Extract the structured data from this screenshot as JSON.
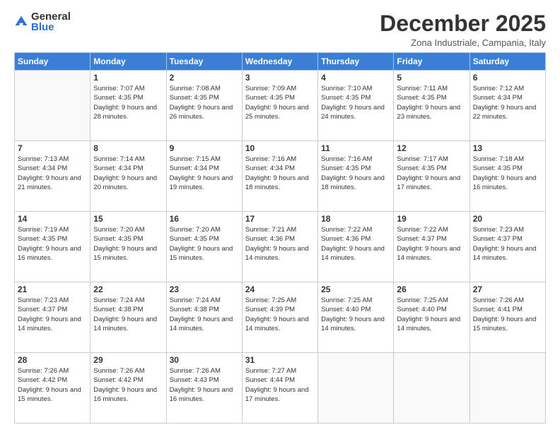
{
  "logo": {
    "general": "General",
    "blue": "Blue"
  },
  "title": "December 2025",
  "subtitle": "Zona Industriale, Campania, Italy",
  "days_header": [
    "Sunday",
    "Monday",
    "Tuesday",
    "Wednesday",
    "Thursday",
    "Friday",
    "Saturday"
  ],
  "weeks": [
    [
      {
        "day": "",
        "info": ""
      },
      {
        "day": "1",
        "sunrise": "7:07 AM",
        "sunset": "4:35 PM",
        "daylight": "9 hours and 28 minutes."
      },
      {
        "day": "2",
        "sunrise": "7:08 AM",
        "sunset": "4:35 PM",
        "daylight": "9 hours and 26 minutes."
      },
      {
        "day": "3",
        "sunrise": "7:09 AM",
        "sunset": "4:35 PM",
        "daylight": "9 hours and 25 minutes."
      },
      {
        "day": "4",
        "sunrise": "7:10 AM",
        "sunset": "4:35 PM",
        "daylight": "9 hours and 24 minutes."
      },
      {
        "day": "5",
        "sunrise": "7:11 AM",
        "sunset": "4:35 PM",
        "daylight": "9 hours and 23 minutes."
      },
      {
        "day": "6",
        "sunrise": "7:12 AM",
        "sunset": "4:34 PM",
        "daylight": "9 hours and 22 minutes."
      }
    ],
    [
      {
        "day": "7",
        "sunrise": "7:13 AM",
        "sunset": "4:34 PM",
        "daylight": "9 hours and 21 minutes."
      },
      {
        "day": "8",
        "sunrise": "7:14 AM",
        "sunset": "4:34 PM",
        "daylight": "9 hours and 20 minutes."
      },
      {
        "day": "9",
        "sunrise": "7:15 AM",
        "sunset": "4:34 PM",
        "daylight": "9 hours and 19 minutes."
      },
      {
        "day": "10",
        "sunrise": "7:16 AM",
        "sunset": "4:34 PM",
        "daylight": "9 hours and 18 minutes."
      },
      {
        "day": "11",
        "sunrise": "7:16 AM",
        "sunset": "4:35 PM",
        "daylight": "9 hours and 18 minutes."
      },
      {
        "day": "12",
        "sunrise": "7:17 AM",
        "sunset": "4:35 PM",
        "daylight": "9 hours and 17 minutes."
      },
      {
        "day": "13",
        "sunrise": "7:18 AM",
        "sunset": "4:35 PM",
        "daylight": "9 hours and 16 minutes."
      }
    ],
    [
      {
        "day": "14",
        "sunrise": "7:19 AM",
        "sunset": "4:35 PM",
        "daylight": "9 hours and 16 minutes."
      },
      {
        "day": "15",
        "sunrise": "7:20 AM",
        "sunset": "4:35 PM",
        "daylight": "9 hours and 15 minutes."
      },
      {
        "day": "16",
        "sunrise": "7:20 AM",
        "sunset": "4:35 PM",
        "daylight": "9 hours and 15 minutes."
      },
      {
        "day": "17",
        "sunrise": "7:21 AM",
        "sunset": "4:36 PM",
        "daylight": "9 hours and 14 minutes."
      },
      {
        "day": "18",
        "sunrise": "7:22 AM",
        "sunset": "4:36 PM",
        "daylight": "9 hours and 14 minutes."
      },
      {
        "day": "19",
        "sunrise": "7:22 AM",
        "sunset": "4:37 PM",
        "daylight": "9 hours and 14 minutes."
      },
      {
        "day": "20",
        "sunrise": "7:23 AM",
        "sunset": "4:37 PM",
        "daylight": "9 hours and 14 minutes."
      }
    ],
    [
      {
        "day": "21",
        "sunrise": "7:23 AM",
        "sunset": "4:37 PM",
        "daylight": "9 hours and 14 minutes."
      },
      {
        "day": "22",
        "sunrise": "7:24 AM",
        "sunset": "4:38 PM",
        "daylight": "9 hours and 14 minutes."
      },
      {
        "day": "23",
        "sunrise": "7:24 AM",
        "sunset": "4:38 PM",
        "daylight": "9 hours and 14 minutes."
      },
      {
        "day": "24",
        "sunrise": "7:25 AM",
        "sunset": "4:39 PM",
        "daylight": "9 hours and 14 minutes."
      },
      {
        "day": "25",
        "sunrise": "7:25 AM",
        "sunset": "4:40 PM",
        "daylight": "9 hours and 14 minutes."
      },
      {
        "day": "26",
        "sunrise": "7:25 AM",
        "sunset": "4:40 PM",
        "daylight": "9 hours and 14 minutes."
      },
      {
        "day": "27",
        "sunrise": "7:26 AM",
        "sunset": "4:41 PM",
        "daylight": "9 hours and 15 minutes."
      }
    ],
    [
      {
        "day": "28",
        "sunrise": "7:26 AM",
        "sunset": "4:42 PM",
        "daylight": "9 hours and 15 minutes."
      },
      {
        "day": "29",
        "sunrise": "7:26 AM",
        "sunset": "4:42 PM",
        "daylight": "9 hours and 16 minutes."
      },
      {
        "day": "30",
        "sunrise": "7:26 AM",
        "sunset": "4:43 PM",
        "daylight": "9 hours and 16 minutes."
      },
      {
        "day": "31",
        "sunrise": "7:27 AM",
        "sunset": "4:44 PM",
        "daylight": "9 hours and 17 minutes."
      },
      {
        "day": "",
        "info": ""
      },
      {
        "day": "",
        "info": ""
      },
      {
        "day": "",
        "info": ""
      }
    ]
  ]
}
